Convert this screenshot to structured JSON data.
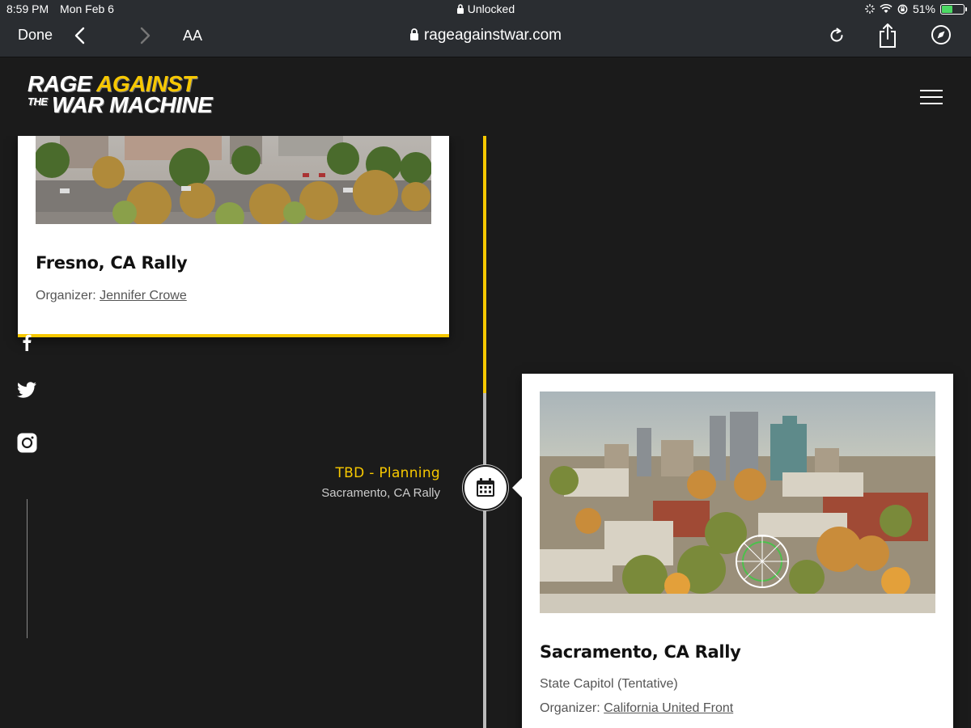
{
  "status_bar": {
    "time": "8:59 PM",
    "date": "Mon Feb 6",
    "lock_status": "Unlocked",
    "battery_percent": "51%",
    "battery_level": 0.51
  },
  "browser": {
    "done_label": "Done",
    "text_size_label": "AA",
    "url": "rageagainstwar.com"
  },
  "site": {
    "logo_line1_a": "RAGE ",
    "logo_line1_b": "AGAINST",
    "logo_the": "THE",
    "logo_line2": "WAR MACHINE",
    "accent_color": "#f7c800"
  },
  "events": [
    {
      "title": "Fresno, CA Rally",
      "organizer_label": "Organizer: ",
      "organizer": "Jennifer Crowe"
    },
    {
      "title": "Sacramento, CA Rally",
      "location": "State Capitol (Tentative)",
      "organizer_label": "Organizer: ",
      "organizer": "California United Front",
      "timeline_date": "TBD - Planning",
      "timeline_name": "Sacramento, CA Rally"
    }
  ],
  "social_icons": [
    "facebook-icon",
    "twitter-icon",
    "instagram-icon"
  ]
}
